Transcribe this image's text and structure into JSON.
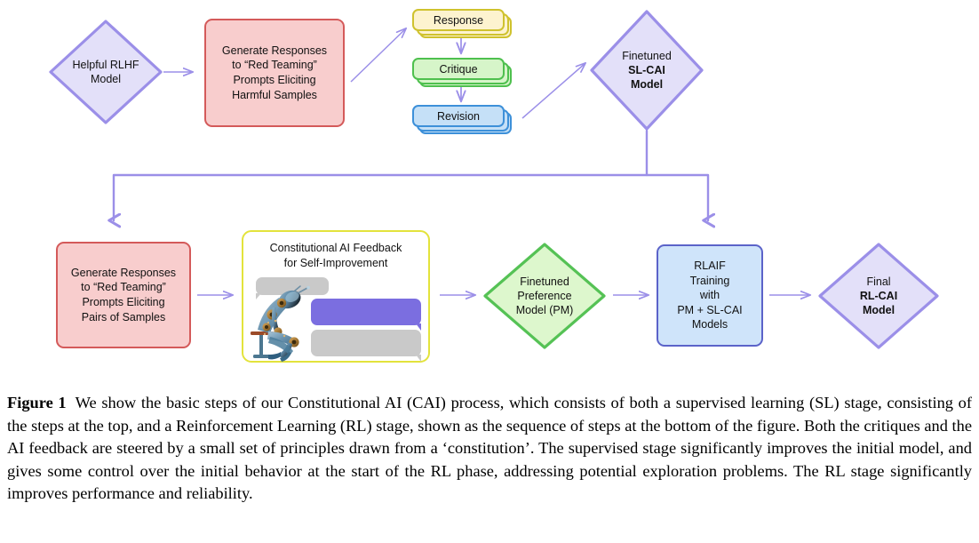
{
  "figure": {
    "caption_label": "Figure 1",
    "caption_text": "We show the basic steps of our Constitutional AI (CAI) process, which consists of both a supervised learning (SL) stage, consisting of the steps at the top, and a Reinforcement Learning (RL) stage, shown as the sequence of steps at the bottom of the figure. Both the critiques and the AI feedback are steered by a small set of principles drawn from a ‘constitution’. The supervised stage significantly improves the initial model, and gives some control over the initial behavior at the start of the RL phase, addressing potential exploration problems. The RL stage significantly improves performance and reliability."
  },
  "diagram": {
    "sl_stage": {
      "helpful_rlhf_model": {
        "line1": "Helpful RLHF",
        "line2": "Model"
      },
      "generate_harmful": {
        "line1": "Generate Responses",
        "line2": "to “Red Teaming”",
        "line3": "Prompts Eliciting",
        "line4": "Harmful Samples"
      },
      "cards": [
        {
          "label": "Response",
          "color": "#fdf3cf",
          "border": "#cfc22e"
        },
        {
          "label": "Critique",
          "color": "#d6f5c9",
          "border": "#4ec04e"
        },
        {
          "label": "Revision",
          "color": "#c5e0f7",
          "border": "#3d90d9"
        }
      ],
      "sl_cai_model": {
        "line1": "Finetuned",
        "line2": "SL-CAI",
        "line3": "Model"
      }
    },
    "rl_stage": {
      "generate_pairs": {
        "line1": "Generate Responses",
        "line2": "to “Red Teaming”",
        "line3": "Prompts Eliciting",
        "line4": "Pairs of Samples"
      },
      "cai_feedback": {
        "title_line1": "Constitutional AI Feedback",
        "title_line2": "for Self-Improvement",
        "robot_icon": "thinker-robot-icon",
        "bubbles": [
          {
            "name": "gray-bubble-top",
            "color": "#c9c9c9"
          },
          {
            "name": "purple-bubble",
            "color": "#7b6ee0"
          },
          {
            "name": "gray-bubble-bottom",
            "color": "#c9c9c9"
          }
        ]
      },
      "preference_model": {
        "line1": "Finetuned",
        "line2": "Preference",
        "line3": "Model (PM)"
      },
      "rlaif_training": {
        "line1": "RLAIF",
        "line2": "Training",
        "line3": "with",
        "line4": "PM + SL-CAI",
        "line5": "Models"
      },
      "rl_cai_model": {
        "line1": "Final",
        "line2": "RL-CAI",
        "line3": "Model"
      }
    },
    "colors": {
      "arrow": "#9b8fe8",
      "diamond_fill": "#e3e0f9",
      "diamond_stroke": "#9b8fe8",
      "green_diamond_fill": "#ddf7cd",
      "green_diamond_stroke": "#55c255",
      "red_fill": "#f8cdcd",
      "red_stroke": "#d45a5a",
      "blue_fill": "#cfe4fa",
      "blue_stroke": "#5b63c9",
      "yellow_stroke": "#e3e33c"
    }
  }
}
